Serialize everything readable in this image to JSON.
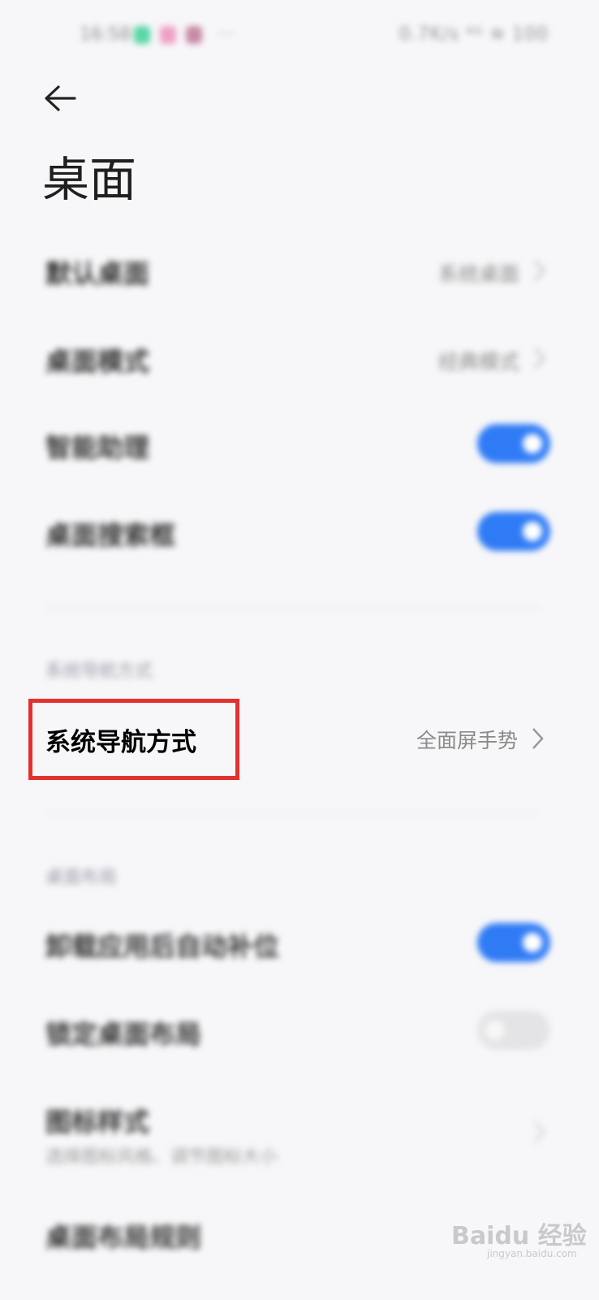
{
  "status_bar": {
    "time": "16:58",
    "right_text": "0.7K/s ⁴ᴳ ≋ 100"
  },
  "header": {
    "title": "桌面"
  },
  "settings_top": [
    {
      "label": "默认桌面",
      "value": "系统桌面",
      "control": "chevron"
    },
    {
      "label": "桌面模式",
      "value": "经典模式",
      "control": "chevron"
    },
    {
      "label": "智能助理",
      "control": "toggle",
      "on": true
    },
    {
      "label": "桌面搜索框",
      "control": "toggle",
      "on": true
    }
  ],
  "section_nav": {
    "header": "系统导航方式",
    "row": {
      "label": "系统导航方式",
      "value": "全面屏手势"
    }
  },
  "section_layout": {
    "header": "桌面布局",
    "rows": [
      {
        "label": "卸载应用后自动补位",
        "control": "toggle",
        "on": true
      },
      {
        "label": "锁定桌面布局",
        "control": "toggle",
        "on": false
      },
      {
        "label": "图标样式",
        "desc": "选择图标风格、调节图标大小",
        "control": "chevron"
      },
      {
        "label": "桌面布局规则"
      }
    ]
  },
  "watermark": {
    "brand": "Baidu 经验",
    "url": "jingyan.baidu.com"
  },
  "colors": {
    "toggle_on": "#2f7bf5",
    "highlight_box": "#e5302e",
    "background": "#f7f7f9"
  }
}
